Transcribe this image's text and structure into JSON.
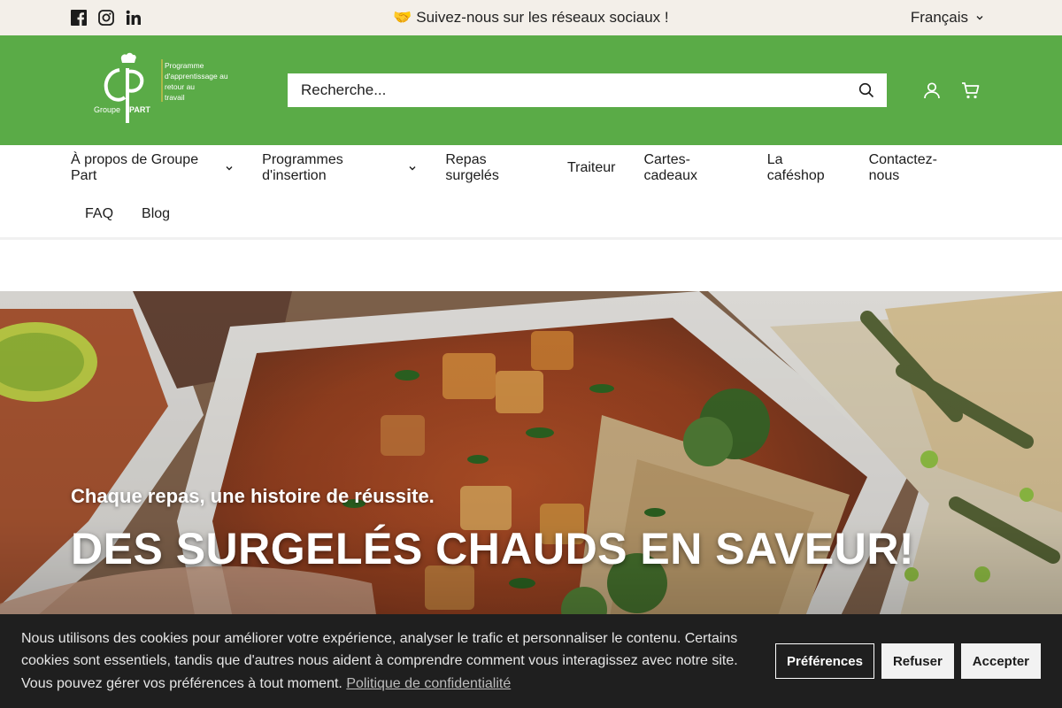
{
  "topbar": {
    "announcement": "🤝 Suivez-nous sur les réseaux sociaux !",
    "language": "Français",
    "social_icons": [
      "facebook-icon",
      "instagram-icon",
      "linkedin-icon"
    ]
  },
  "header": {
    "logo": {
      "brand_lines": [
        "Groupe",
        "PART"
      ],
      "tagline_lines": [
        "Programme",
        "d'apprentissage au",
        "retour au",
        "travail"
      ]
    },
    "search_placeholder": "Recherche...",
    "icons": [
      "account-icon",
      "cart-icon"
    ],
    "background_color": "#5aab47"
  },
  "nav": {
    "items": [
      {
        "label": "À propos de Groupe Part",
        "has_dropdown": true
      },
      {
        "label": "Programmes d'insertion",
        "has_dropdown": true
      },
      {
        "label": "Repas surgelés",
        "has_dropdown": false
      },
      {
        "label": "Traiteur",
        "has_dropdown": false
      },
      {
        "label": "Cartes-cadeaux",
        "has_dropdown": false
      },
      {
        "label": "La caféshop",
        "has_dropdown": false
      },
      {
        "label": "Contactez-nous",
        "has_dropdown": false
      },
      {
        "label": "FAQ",
        "has_dropdown": false
      },
      {
        "label": "Blog",
        "has_dropdown": false
      }
    ]
  },
  "hero": {
    "subtitle": "Chaque repas, une histoire de réussite.",
    "title": "DES SURGELÉS CHAUDS EN SAVEUR!"
  },
  "cookie_banner": {
    "text": "Nous utilisons des cookies pour améliorer votre expérience, analyser le trafic et personnaliser le contenu. Certains cookies sont essentiels, tandis que d'autres nous aident à comprendre comment vous interagissez avec notre site. Vous pouvez gérer vos préférences à tout moment.",
    "privacy_link": "Politique de confidentialité",
    "buttons": {
      "preferences": "Préférences",
      "refuse": "Refuser",
      "accept": "Accepter"
    }
  }
}
